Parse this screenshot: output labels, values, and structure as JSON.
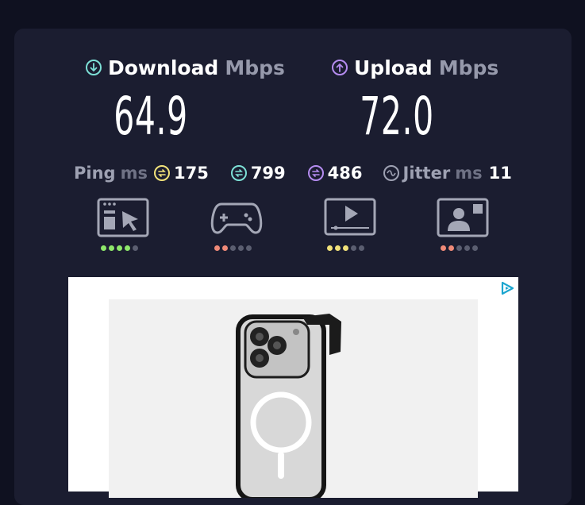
{
  "download": {
    "label": "Download",
    "unit": "Mbps",
    "value": "64.9",
    "color": "#7de0d6"
  },
  "upload": {
    "label": "Upload",
    "unit": "Mbps",
    "value": "72.0",
    "color": "#b58cf0"
  },
  "stats": {
    "ping_label": "Ping",
    "ping_unit": "ms",
    "ping_idle": "175",
    "ping_down": "799",
    "ping_up": "486",
    "jitter_label": "Jitter",
    "jitter_unit": "ms",
    "jitter_value": "11"
  },
  "activities": [
    {
      "icon": "browsing-icon",
      "rating": 4,
      "of": 5,
      "color": "#8ee86a"
    },
    {
      "icon": "gaming-icon",
      "rating": 2,
      "of": 5,
      "color": "#f08a78"
    },
    {
      "icon": "video-streaming-icon",
      "rating": 3,
      "of": 5,
      "color": "#f2e27a"
    },
    {
      "icon": "video-call-icon",
      "rating": 2,
      "of": 5,
      "color": "#f08a78"
    }
  ],
  "ad": {
    "choices_icon": "ad-choices-icon",
    "image": "phone-case-image"
  }
}
